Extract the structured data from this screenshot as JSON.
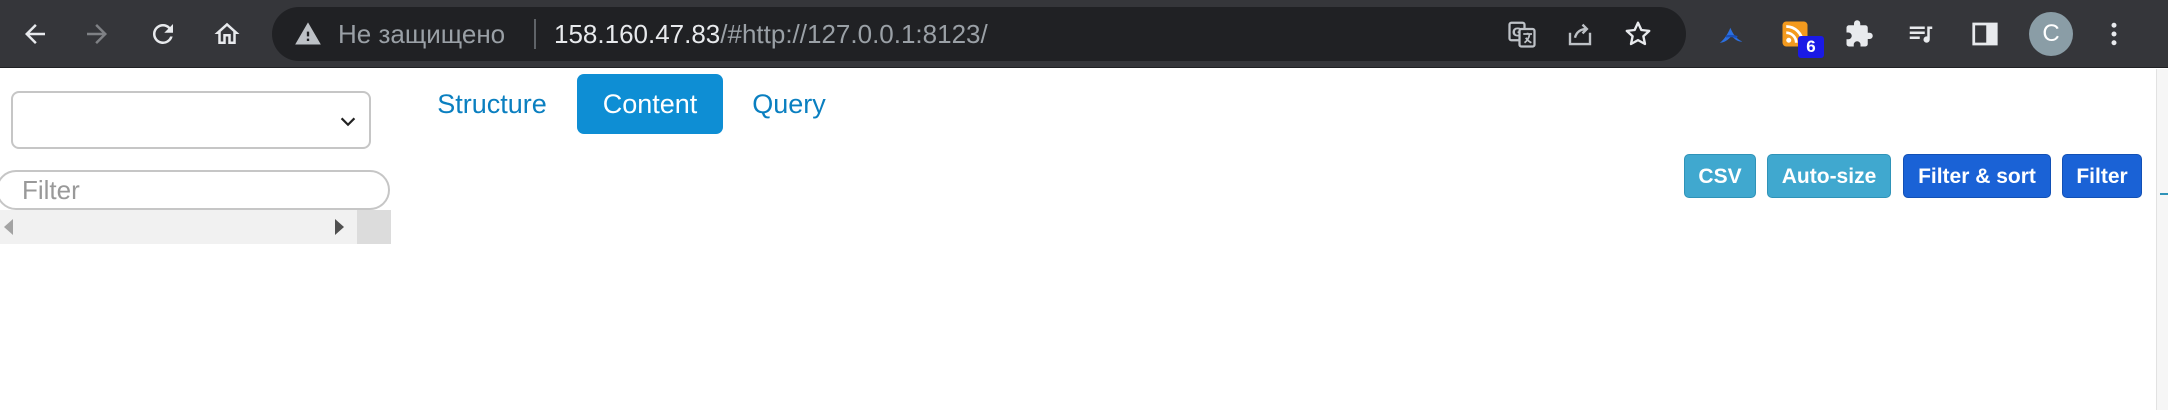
{
  "browser": {
    "omnibox": {
      "security_label": "Не защищено",
      "url_host": "158.160.47.83",
      "url_path": "/#http://127.0.0.1:8123/"
    },
    "extensions": {
      "rss_badge": "6"
    },
    "profile_initial": "C"
  },
  "app": {
    "database_select": {
      "selected": ""
    },
    "sidebar_filter": {
      "placeholder": "Filter"
    },
    "tabs": [
      {
        "label": "Structure",
        "active": false
      },
      {
        "label": "Content",
        "active": true
      },
      {
        "label": "Query",
        "active": false
      }
    ],
    "toolbar": {
      "csv_label": "CSV",
      "autosize_label": "Auto-size",
      "filter_sort_label": "Filter & sort",
      "filter_label": "Filter"
    }
  },
  "colors": {
    "chrome_bg": "#35363a",
    "omnibox_bg": "#202124",
    "tab_active": "#0e8ed4",
    "link_blue": "#0a7fc0",
    "button_light": "#40a8cf",
    "button_dark": "#1a62d6"
  }
}
